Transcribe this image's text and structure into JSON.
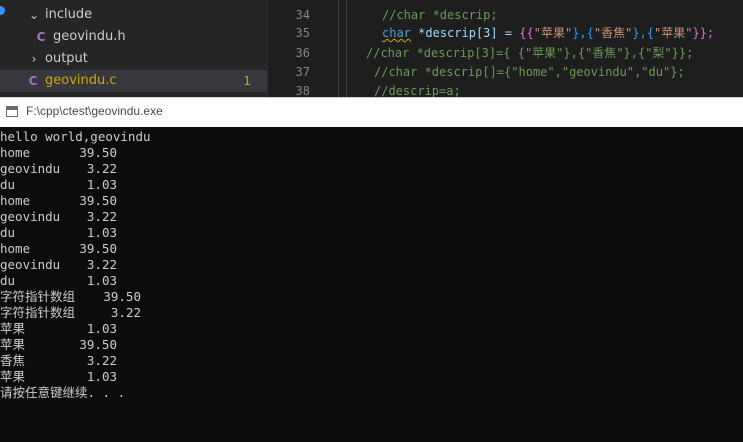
{
  "explorer": {
    "items": [
      {
        "chevron": "chevron-down",
        "label": "include"
      },
      {
        "icon": "C",
        "label": "geovindu.h"
      },
      {
        "chevron": "chevron-right",
        "label": "output"
      },
      {
        "icon": "C",
        "label": "geovindu.c",
        "badge": "1",
        "active": true
      }
    ]
  },
  "editor": {
    "lines": [
      {
        "number": "34"
      },
      {
        "number": "35"
      },
      {
        "number": "36"
      },
      {
        "number": "37"
      },
      {
        "number": "38"
      }
    ],
    "tokens": {
      "l34_comment": "//char *descrip;",
      "l35_kw": "char",
      "l35_id": "*descrip[3] = ",
      "l35_a": "{{",
      "l35_s1": "\"苹果\"",
      "l35_b": "},{",
      "l35_s2": "\"香焦\"",
      "l35_c": "},{",
      "l35_s3": "\"苹果\"",
      "l35_d": "}};",
      "l36_comment": "//char *descrip[3]={ {\"苹果\"},{\"香焦\"},{\"梨\"}};",
      "l37_comment": "//char *descrip[]={\"home\",\"geovindu\",\"du\"};",
      "l38_comment": "//descrip=a;"
    }
  },
  "console": {
    "title": "F:\\cpp\\ctest\\geovindu.exe",
    "greeting": "hello world,geovindu",
    "rows": [
      {
        "name": "home",
        "value": "39.50"
      },
      {
        "name": "geovindu",
        "value": "3.22"
      },
      {
        "name": "du",
        "value": "1.03"
      },
      {
        "name": "home",
        "value": "39.50"
      },
      {
        "name": "geovindu",
        "value": "3.22"
      },
      {
        "name": "du",
        "value": "1.03"
      },
      {
        "name": "home",
        "value": "39.50"
      },
      {
        "name": "geovindu",
        "value": "3.22"
      },
      {
        "name": "du",
        "value": "1.03"
      },
      {
        "name": "字符指针数组",
        "value": "39.50"
      },
      {
        "name": "字符指针数组",
        "value": "3.22"
      },
      {
        "name": "苹果",
        "value": "1.03"
      },
      {
        "name": "苹果",
        "value": "39.50"
      },
      {
        "name": "香焦",
        "value": "3.22"
      },
      {
        "name": "苹果",
        "value": "1.03"
      }
    ],
    "prompt": "请按任意键继续. . ."
  },
  "colors": {
    "editor_bg": "#1e1e1e",
    "sidebar_bg": "#252526",
    "active_row_bg": "#37373d",
    "console_bg": "#0c0c0c",
    "console_text": "#cccccc",
    "c_icon": "#a074c4",
    "badge": "#cca700"
  }
}
